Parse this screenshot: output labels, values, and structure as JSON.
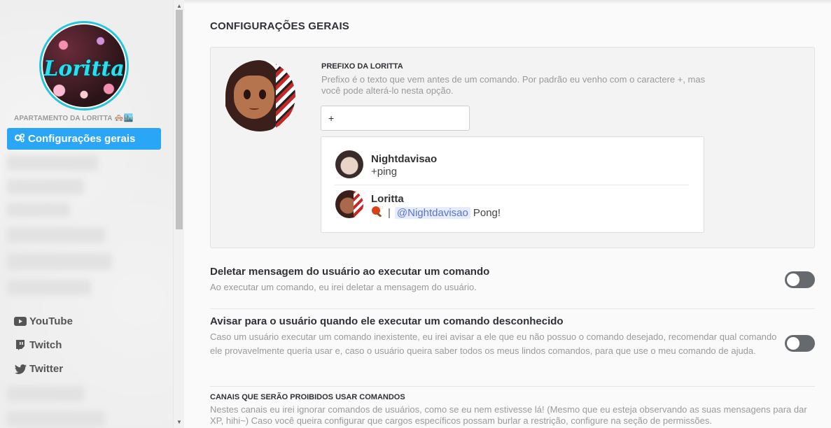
{
  "sidebar": {
    "avatar_logo": "Loritta",
    "server_name": "APARTAMENTO DA LORITTA",
    "server_emojis": "🏘️🏙️",
    "active_item": {
      "icon": "gears-icon",
      "label": "Configurações gerais"
    },
    "social": [
      {
        "icon": "youtube-icon",
        "label": "YouTube"
      },
      {
        "icon": "twitch-icon",
        "label": "Twitch"
      },
      {
        "icon": "twitter-icon",
        "label": "Twitter"
      }
    ]
  },
  "main": {
    "title": "CONFIGURAÇÕES GERAIS",
    "prefix": {
      "label": "PREFIXO DA LORITTA",
      "description": "Prefixo é o texto que vem antes de um comando. Por padrão eu venho com o caractere +, mas você pode alterá-lo nesta opção.",
      "value": "+",
      "preview": {
        "user_name": "Nightdavisao",
        "user_message": "+ping",
        "bot_name": "Loritta",
        "bot_separator": "|",
        "bot_mention": "@Nightdavisao",
        "bot_reply": "Pong!"
      }
    },
    "settings": [
      {
        "title": "Deletar mensagem do usuário ao executar um comando",
        "description": "Ao executar um comando, eu irei deletar a mensagem do usuário.",
        "enabled": false
      },
      {
        "title": "Avisar para o usuário quando ele executar um comando desconhecido",
        "description": "Caso um usuário executar um comando inexistente, eu irei avisar a ele que eu não possuo o comando desejado, recomendar qual comando ele provavelmente queria usar e, caso o usuário queira saber todos os meus lindos comandos, para que use o meu comando de ajuda.",
        "enabled": false
      }
    ],
    "blocked_channels": {
      "title": "CANAIS QUE SERÃO PROIBIDOS USAR COMANDOS",
      "description": "Nestes canais eu irei ignorar comandos de usuários, como se eu nem estivesse lá! (Mesmo que eu esteja observando as suas mensagens para dar XP, hihi~) Caso você queira configurar que cargos específicos possam burlar a restrição, configure na seção de permissões."
    }
  },
  "colors": {
    "accent": "#29a6f5",
    "toggle_off": "#666a6e",
    "logo": "#29e0f0",
    "mention_bg": "#e6ecff",
    "mention_text": "#5b73c7"
  }
}
